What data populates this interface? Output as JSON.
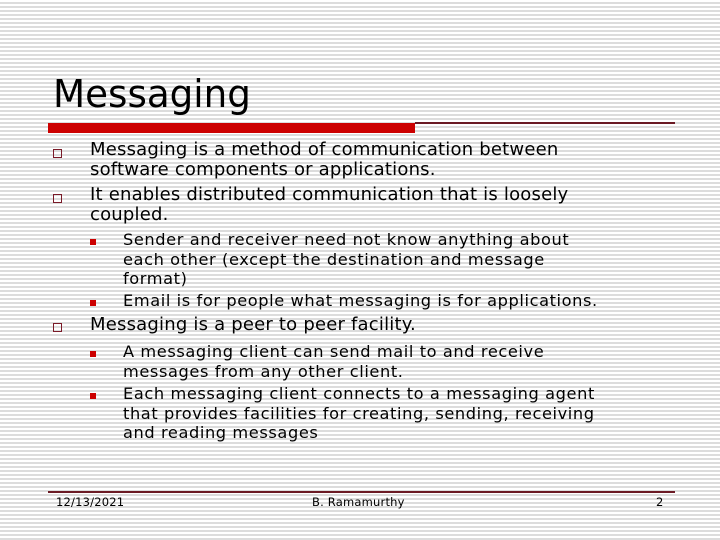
{
  "slide": {
    "title": "Messaging",
    "bullets": [
      {
        "lines": [
          "Messaging is a method of communication between",
          "software components or applications."
        ],
        "sub": []
      },
      {
        "lines": [
          "It enables distributed communication that is loosely",
          "coupled."
        ],
        "sub": [
          {
            "lines": [
              "Sender and receiver need not know anything about",
              "each other (except the destination and message",
              "format)"
            ]
          },
          {
            "lines": [
              "Email is for people what messaging is for applications."
            ]
          }
        ]
      },
      {
        "lines": [
          "Messaging is a peer to peer facility."
        ],
        "sub": [
          {
            "lines": [
              "A messaging client can send mail to and receive",
              "messages from any other client."
            ]
          },
          {
            "lines": [
              "Each messaging client connects to a messaging agent",
              "that provides facilities for creating, sending, receiving",
              "and reading messages"
            ]
          }
        ]
      }
    ]
  },
  "footer": {
    "date": "12/13/2021",
    "author": "B. Ramamurthy",
    "page": "2"
  },
  "colors": {
    "accent": "#cc0000",
    "rule": "#6b1a24",
    "bullet_outline": "#7a1a28"
  }
}
